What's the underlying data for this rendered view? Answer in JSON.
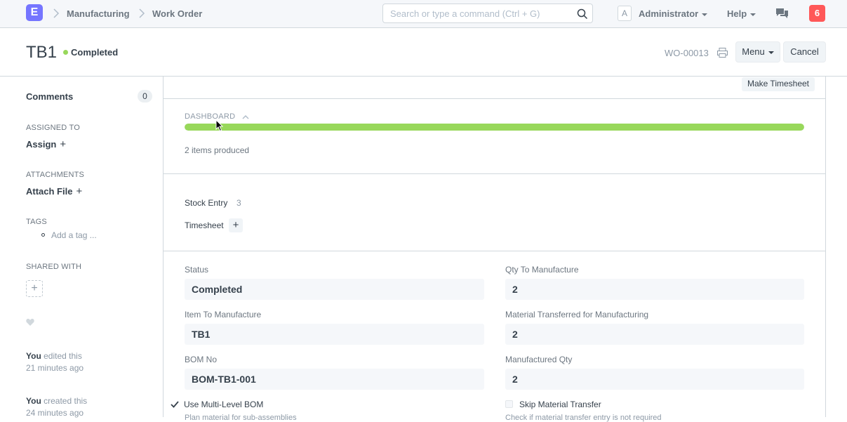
{
  "navbar": {
    "logo_letter": "E",
    "breadcrumbs": [
      "Manufacturing",
      "Work Order"
    ],
    "search_placeholder": "Search or type a command (Ctrl + G)",
    "avatar_letter": "A",
    "user_label": "Administrator",
    "help_label": "Help",
    "notification_count": "6"
  },
  "header": {
    "title": "TB1",
    "status": "Completed",
    "doc_id": "WO-00013",
    "menu_label": "Menu",
    "cancel_label": "Cancel"
  },
  "sidebar": {
    "comments_label": "Comments",
    "comments_count": "0",
    "assigned_label": "ASSIGNED TO",
    "assign_label": "Assign",
    "attachments_label": "ATTACHMENTS",
    "attach_label": "Attach File",
    "tags_label": "TAGS",
    "add_tag_label": "Add a tag ...",
    "shared_label": "SHARED WITH",
    "timeline": [
      {
        "who": "You",
        "action": "edited this",
        "when": "21 minutes ago"
      },
      {
        "who": "You",
        "action": "created this",
        "when": "24 minutes ago"
      }
    ]
  },
  "main": {
    "make_timesheet_label": "Make Timesheet",
    "dashboard_label": "DASHBOARD",
    "progress_percent": 100,
    "produced_text": "2 items produced",
    "stock_entry_label": "Stock Entry",
    "stock_entry_count": "3",
    "timesheet_label": "Timesheet",
    "fields": {
      "status_label": "Status",
      "status_value": "Completed",
      "qty_label": "Qty To Manufacture",
      "qty_value": "2",
      "item_label": "Item To Manufacture",
      "item_value": "TB1",
      "transferred_label": "Material Transferred for Manufacturing",
      "transferred_value": "2",
      "bom_label": "BOM No",
      "bom_value": "BOM-TB1-001",
      "manufactured_label": "Manufactured Qty",
      "manufactured_value": "2"
    },
    "multi_level_label": "Use Multi-Level BOM",
    "skip_transfer_label": "Skip Material Transfer",
    "multi_level_help": "Plan material for sub-assemblies",
    "skip_transfer_help": "Check if material transfer entry is not required"
  },
  "colors": {
    "brand": "#7575ff",
    "status_green": "#98d85b",
    "notification_red": "#ff5858"
  }
}
